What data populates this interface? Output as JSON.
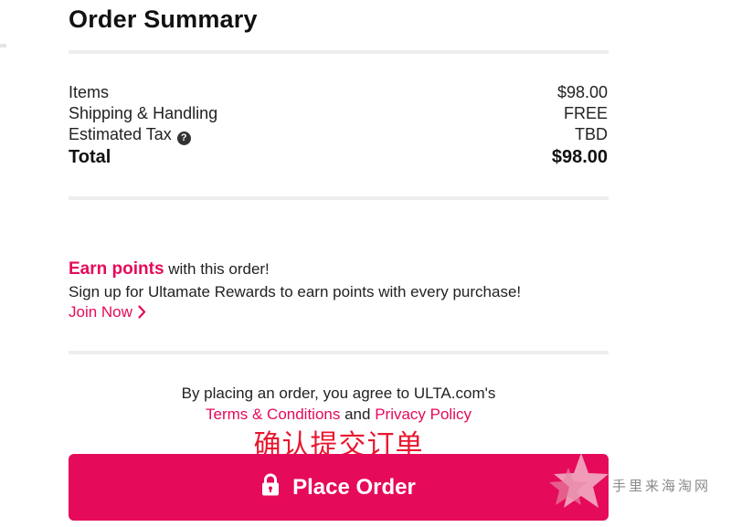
{
  "summary": {
    "title": "Order Summary",
    "rows": [
      {
        "label": "Items",
        "value": "$98.00"
      },
      {
        "label": "Shipping & Handling",
        "value": "FREE"
      },
      {
        "label": "Estimated Tax",
        "value": "TBD"
      }
    ],
    "total": {
      "label": "Total",
      "value": "$98.00"
    },
    "help_icon_glyph": "?"
  },
  "rewards": {
    "headline_highlight": "Earn points",
    "headline_rest": " with this order!",
    "description": "Sign up for Ultamate Rewards to earn points with every purchase!",
    "join_label": "Join Now"
  },
  "agreement": {
    "text": "By placing an order, you agree to ULTA.com's",
    "terms_label": "Terms & Conditions",
    "and_text": " and ",
    "privacy_label": "Privacy Policy"
  },
  "annotation": {
    "caption": "确认提交订单"
  },
  "action": {
    "place_order_label": "Place Order"
  },
  "watermark": {
    "text": "手里来海淘网"
  },
  "colors": {
    "brand": "#e60a5a",
    "link": "#e50a5b",
    "caption": "#e8162f",
    "divider": "#eeeeee"
  },
  "icons": {
    "help": "question-circle-icon",
    "join": "chevron-right-icon",
    "place_order": "lock-icon",
    "watermark": "star-icon"
  }
}
